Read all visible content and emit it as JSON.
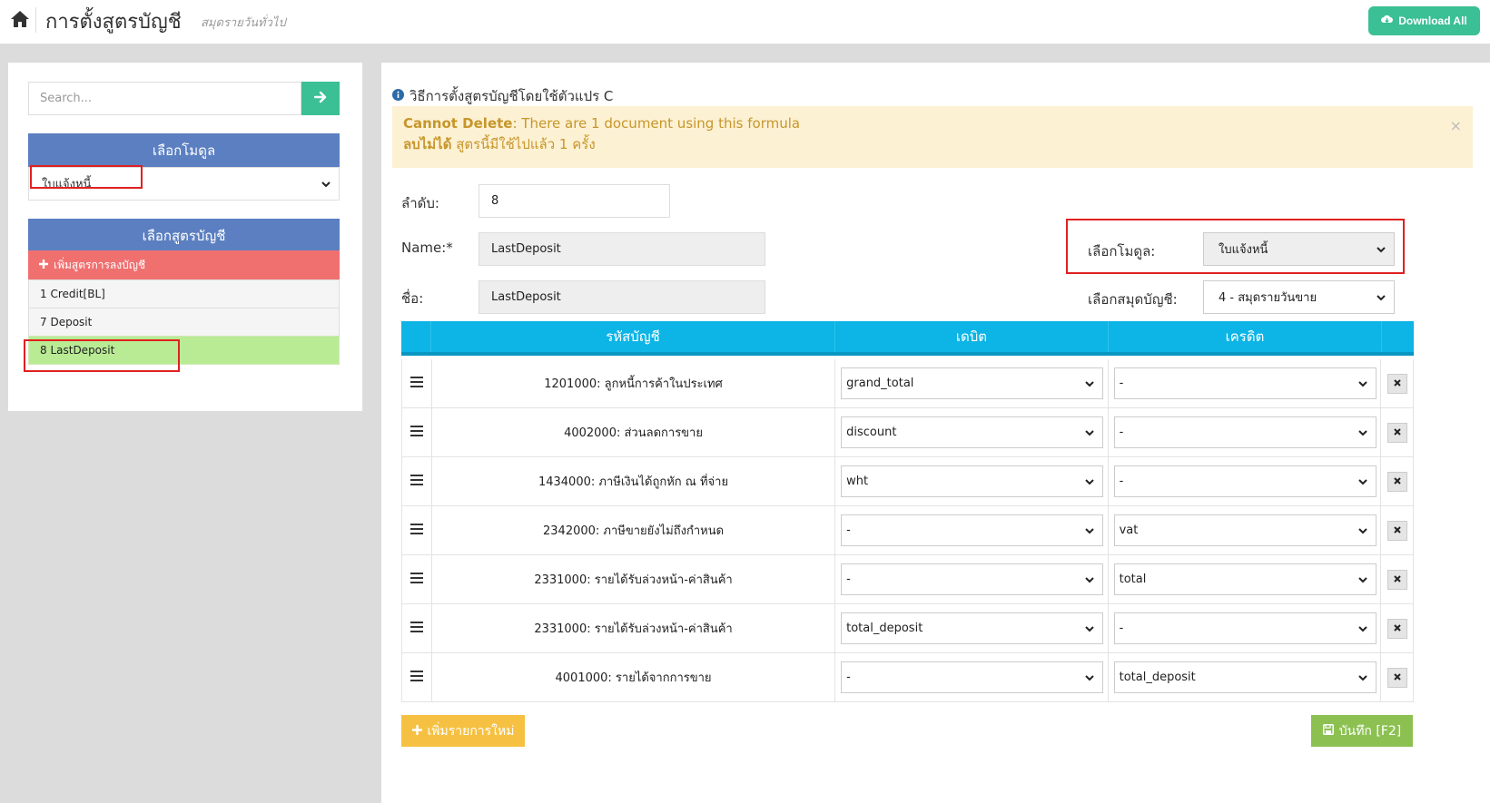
{
  "header": {
    "title": "การตั้งสูตรบัญชี",
    "subtitle": "สมุดรายวันทั่วไป",
    "download_label": "Download All"
  },
  "sidebar": {
    "search_placeholder": "Search...",
    "module_header": "เลือกโมดูล",
    "module_selected": "ใบแจ้งหนี้",
    "formula_header": "เลือกสูตรบัญชี",
    "add_formula_label": "เพิ่มสูตรการลงบัญชี",
    "formulas": [
      {
        "label": "1 Credit[BL]"
      },
      {
        "label": "7 Deposit"
      },
      {
        "label": "8 LastDeposit"
      }
    ]
  },
  "main": {
    "section_title": "วิธีการตั้งสูตรบัญชีโดยใช้ตัวแปร C",
    "alert": {
      "line1_strong": "Cannot Delete",
      "line1_text": ": There are 1 document using this formula",
      "line2_strong": "ลบไม่ได้",
      "line2_text": " สูตรนี้มีใช้ไปแล้ว 1 ครั้ง",
      "close": "×"
    },
    "form": {
      "order_label": "ลำดับ:",
      "order_value": "8",
      "name_label": "Name:*",
      "name_value": "LastDeposit",
      "thai_name_label": "ชื่อ:",
      "thai_name_value": "LastDeposit",
      "module_label": "เลือกโมดูล:",
      "module_value": "ใบแจ้งหนี้",
      "journal_label": "เลือกสมุดบัญชี:",
      "journal_value": "4 - สมุดรายวันขาย"
    },
    "table": {
      "headers": {
        "account": "รหัสบัญชี",
        "debit": "เดบิต",
        "credit": "เครดิต"
      },
      "rows": [
        {
          "account": "1201000: ลูกหนี้การค้าในประเทศ",
          "debit": "grand_total",
          "credit": "-"
        },
        {
          "account": "4002000: ส่วนลดการขาย",
          "debit": "discount",
          "credit": "-"
        },
        {
          "account": "1434000: ภาษีเงินได้ถูกหัก ณ ที่จ่าย",
          "debit": "wht",
          "credit": "-"
        },
        {
          "account": "2342000: ภาษีขายยังไม่ถึงกำหนด",
          "debit": "-",
          "credit": "vat"
        },
        {
          "account": "2331000: รายได้รับล่วงหน้า-ค่าสินค้า",
          "debit": "-",
          "credit": "total"
        },
        {
          "account": "2331000: รายได้รับล่วงหน้า-ค่าสินค้า",
          "debit": "total_deposit",
          "credit": "-"
        },
        {
          "account": "4001000: รายได้จากการขาย",
          "debit": "-",
          "credit": "total_deposit"
        }
      ]
    },
    "add_item_label": "เพิ่มรายการใหม่",
    "save_label": "บันทึก [F2]"
  },
  "colors": {
    "accent_green": "#3bbf94",
    "header_blue": "#5b7fc0",
    "table_cyan": "#0db4e6",
    "add_red": "#f07070",
    "active_green": "#b8eb94",
    "alert_bg": "#fdf1d4",
    "highlight_red": "#e02020"
  }
}
